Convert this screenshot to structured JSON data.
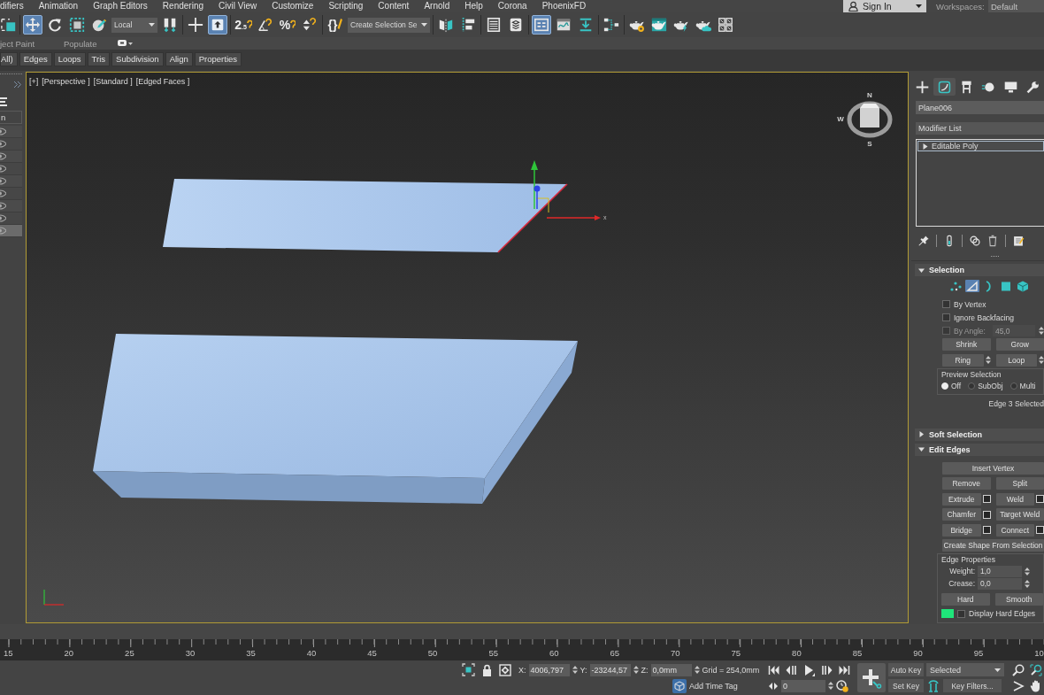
{
  "menu_bar": {
    "items": [
      "difiers",
      "Animation",
      "Graph Editors",
      "Rendering",
      "Civil View",
      "Customize",
      "Scripting",
      "Content",
      "Arnold",
      "Help",
      "Corona",
      "PhoenixFD"
    ],
    "sign_in": "Sign In",
    "workspaces_label": "Workspaces:",
    "workspace": "Default"
  },
  "main_toolbar": {
    "groups": [
      [
        {
          "kind": "tool",
          "on": false
        }
      ],
      [
        {
          "kind": "tool",
          "on": true
        },
        {
          "kind": "tool",
          "on": false
        },
        {
          "kind": "tool",
          "on": false
        },
        {
          "kind": "tool",
          "on": false
        },
        {
          "kind": "dropdown",
          "value": "Local"
        },
        {
          "kind": "tool",
          "on": false
        }
      ],
      [
        {
          "kind": "tool",
          "on": false
        },
        {
          "kind": "tool",
          "on": true
        }
      ],
      [
        {
          "kind": "tool",
          "on": false,
          "glyph": "2$_{.5}$"
        },
        {
          "kind": "tool",
          "on": false
        },
        {
          "kind": "tool",
          "on": false,
          "glyph": "%"
        },
        {
          "kind": "tool",
          "on": false
        }
      ],
      [
        {
          "kind": "tool",
          "on": false,
          "glyph": "{}"
        },
        {
          "kind": "dropdown",
          "value": "Create Selection Se"
        }
      ],
      [
        {
          "kind": "tool",
          "on": false
        },
        {
          "kind": "tool",
          "on": false
        }
      ],
      [
        {
          "kind": "tool",
          "on": false
        },
        {
          "kind": "tool",
          "on": false
        }
      ],
      [
        {
          "kind": "tool",
          "on": true
        },
        {
          "kind": "tool",
          "on": false
        },
        {
          "kind": "tool",
          "on": false
        }
      ],
      [
        {
          "kind": "tool",
          "on": false
        }
      ],
      [
        {
          "kind": "tool",
          "on": false
        },
        {
          "kind": "tool",
          "on": false
        },
        {
          "kind": "tool",
          "on": false
        },
        {
          "kind": "tool",
          "on": false
        },
        {
          "kind": "tool",
          "on": false
        }
      ]
    ]
  },
  "ribbon": {
    "tabs": [
      "ject Paint",
      "Populate"
    ],
    "panels": [
      "All)",
      "Edges",
      "Loops",
      "Tris",
      "Subdivision",
      "Align",
      "Properties"
    ]
  },
  "scene_explorer": {
    "header": "n",
    "rows": [
      {
        "selected": false
      },
      {
        "selected": false
      },
      {
        "selected": false
      },
      {
        "selected": false
      },
      {
        "selected": false
      },
      {
        "selected": false
      },
      {
        "selected": false
      },
      {
        "selected": false
      },
      {
        "selected": true
      }
    ]
  },
  "viewport": {
    "active": true,
    "labels": [
      "[+]",
      "[Perspective ]",
      "[Standard ]",
      "[Edged Faces ]"
    ],
    "viewcube": [
      "N",
      "W",
      "S"
    ],
    "gizmo_label": "x"
  },
  "command_panel": {
    "tabs": [
      {
        "selected": false
      },
      {
        "selected": true
      },
      {
        "selected": false
      },
      {
        "selected": false
      },
      {
        "selected": false
      },
      {
        "selected": false
      }
    ],
    "object_name": "Plane006",
    "modifier_list": "Modifier List",
    "stack": [
      {
        "label": "Editable Poly",
        "selected": true,
        "expanded": false
      }
    ],
    "rollouts": [
      {
        "title": "Selection",
        "expanded": true,
        "rows": [
          {
            "kind": "subobjects",
            "items": [
              {
                "selected": false
              },
              {
                "selected": true
              },
              {
                "selected": false
              },
              {
                "selected": false
              },
              {
                "selected": false
              }
            ]
          },
          {
            "kind": "checkbox",
            "label": "By Vertex",
            "checked": false
          },
          {
            "kind": "checkbox",
            "label": "Ignore Backfacing",
            "checked": false
          },
          {
            "kind": "angle",
            "label": "By Angle:",
            "checked": false,
            "value": "45,0",
            "disabled": true
          },
          {
            "kind": "buttons",
            "items": [
              {
                "label": "Shrink"
              },
              {
                "label": "Grow"
              }
            ]
          },
          {
            "kind": "buttons",
            "items": [
              {
                "label": "Ring",
                "spinner": true
              },
              {
                "label": "Loop",
                "spinner": true
              }
            ]
          },
          {
            "kind": "radios",
            "title": "Preview Selection",
            "items": [
              {
                "label": "Off",
                "selected": true
              },
              {
                "label": "SubObj",
                "selected": false
              },
              {
                "label": "Multi",
                "selected": false
              }
            ]
          },
          {
            "kind": "status",
            "text": "Edge 3 Selected"
          }
        ]
      },
      {
        "title": "Soft Selection",
        "expanded": false
      },
      {
        "title": "Edit Edges",
        "expanded": true,
        "rows": [
          {
            "kind": "buttons",
            "items": [
              {
                "label": "Insert Vertex"
              }
            ]
          },
          {
            "kind": "buttons",
            "items": [
              {
                "label": "Remove"
              },
              {
                "label": "Split"
              }
            ]
          },
          {
            "kind": "buttons",
            "items": [
              {
                "label": "Extrude",
                "settings": true
              },
              {
                "label": "Weld",
                "settings": true
              }
            ]
          },
          {
            "kind": "buttons",
            "items": [
              {
                "label": "Chamfer",
                "settings": true
              },
              {
                "label": "Target Weld",
                "settings": false
              }
            ]
          },
          {
            "kind": "buttons",
            "items": [
              {
                "label": "Bridge",
                "settings": true
              },
              {
                "label": "Connect",
                "settings": true
              }
            ]
          },
          {
            "kind": "buttons",
            "items": [
              {
                "label": "Create Shape From Selection"
              }
            ]
          },
          {
            "kind": "group",
            "title": "Edge Properties",
            "rows": [
              {
                "kind": "spinner",
                "label": "Weight:",
                "value": "1,0"
              },
              {
                "kind": "spinner",
                "label": "Crease:",
                "value": "0,0"
              },
              {
                "kind": "buttons",
                "items": [
                  {
                    "label": "Hard"
                  },
                  {
                    "label": "Smooth"
                  }
                ]
              },
              {
                "kind": "swatch_check",
                "label": "Display Hard Edges",
                "color": "#1fe57a",
                "checked": false
              }
            ]
          }
        ]
      }
    ]
  },
  "timeline": {
    "frames": [
      "15",
      "20",
      "25",
      "30",
      "35",
      "40",
      "45",
      "50",
      "55",
      "60",
      "65",
      "70",
      "75",
      "80",
      "85",
      "90",
      "95",
      "10"
    ]
  },
  "status_bar": {
    "coords": [
      {
        "label": "X:",
        "value": "4006,797"
      },
      {
        "label": "Y:",
        "value": "-23244,57"
      },
      {
        "label": "Z:",
        "value": "0,0mm"
      }
    ],
    "grid": "Grid = 254,0mm",
    "time_tag": "Add Time Tag",
    "frame": "0",
    "auto_key": "Auto Key",
    "key_mode": "Selected",
    "set_key": "Set Key",
    "key_filters": "Key Filters..."
  }
}
